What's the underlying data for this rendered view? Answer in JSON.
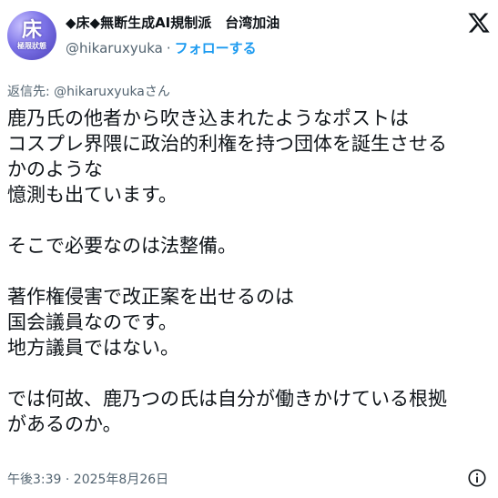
{
  "author": {
    "display_name": "◆床◆無断生成AI規制派　台湾加油",
    "handle": "@hikaruxyuka",
    "separator": "·",
    "follow_label": "フォローする",
    "avatar_text_main": "床",
    "avatar_text_sub": "極限狀態"
  },
  "tweet": {
    "reply_to": "返信先: @hikaruxyukaさん",
    "lines": [
      "鹿乃氏の他者から吹き込まれたようなポストは",
      "コスプレ界隈に政治的利権を持つ団体を誕生させる",
      "かのような",
      "憶測も出ています。",
      "",
      "そこで必要なのは法整備。",
      "",
      "著作権侵害で改正案を出せるのは",
      "国会議員なのです。",
      "地方議員ではない。",
      "",
      "では何故、鹿乃つの氏は自分が働きかけている根拠",
      "があるのか。"
    ],
    "timestamp": "午後3:39 · 2025年8月26日"
  },
  "icons": {
    "logo": "x-logo-icon",
    "info": "info-icon"
  }
}
